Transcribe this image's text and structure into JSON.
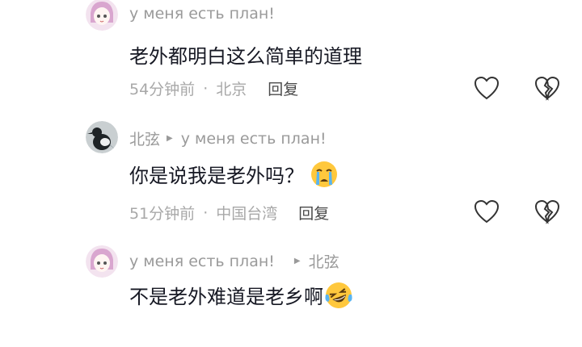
{
  "comments": [
    {
      "username": "у меня есть план!",
      "reply_to": "",
      "text": "老外都明白这么简单的道理",
      "emoji": "",
      "time": "54分钟前",
      "location": "北京",
      "reply_label": "回复",
      "avatar": "anime-girl-avatar"
    },
    {
      "username": "北弦",
      "reply_to": "у меня есть план!",
      "text": "你是说我是老外吗？",
      "emoji": "crying-face",
      "time": "51分钟前",
      "location": "中国台湾",
      "reply_label": "回复",
      "avatar": "magpie-bird-avatar"
    },
    {
      "username": "у меня есть план!",
      "reply_to": "北弦",
      "text": "不是老外难道是老乡啊",
      "emoji": "laughing-tears-face",
      "time": "",
      "location": "",
      "reply_label": "",
      "avatar": "anime-girl-avatar"
    }
  ],
  "icons": {
    "like": "heart-outline-icon",
    "dislike": "broken-heart-icon"
  },
  "colors": {
    "text": "#161823",
    "secondary": "#9a9a9a",
    "emoji": "#ffc83d"
  }
}
